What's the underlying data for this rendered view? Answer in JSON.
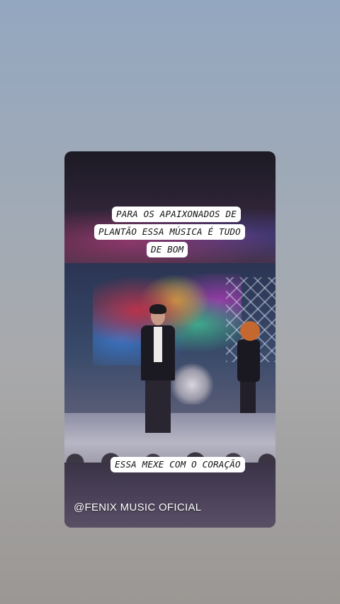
{
  "story": {
    "caption_top": {
      "line1": "PARA OS APAIXONADOS DE",
      "line2": "PLANTÃO  ESSA MÚSICA  É TUDO",
      "line3": "DE BOM"
    },
    "caption_bottom": "ESSA MEXE COM O CORAÇÃO",
    "watermark": "@FENIX MUSIC OFICIAL",
    "colors": {
      "caption_bg": "#ffffff",
      "caption_text": "#111111",
      "watermark_text": "#ffffff"
    }
  }
}
